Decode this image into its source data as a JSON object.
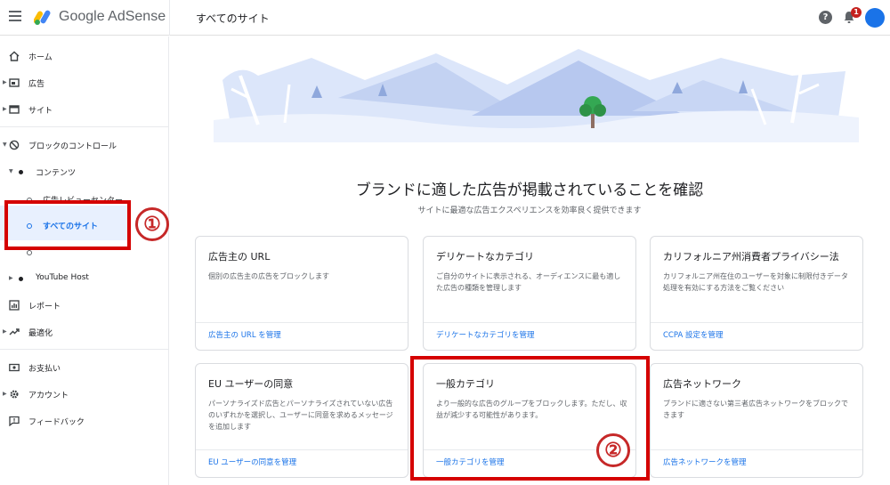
{
  "header": {
    "brand": "Google AdSense",
    "page_title": "すべてのサイト",
    "help_icon": "help-icon",
    "notification_count": "1",
    "colors": {
      "brand_blue": "#4285f4",
      "brand_yellow": "#fbbc04",
      "brand_green": "#34a853",
      "badge_red": "#c5221f"
    }
  },
  "sidebar": {
    "items": [
      {
        "label": "ホーム",
        "icon": "home-icon"
      },
      {
        "label": "広告",
        "icon": "ads-icon"
      },
      {
        "label": "サイト",
        "icon": "sites-icon"
      },
      {
        "label": "ブロックのコントロール",
        "icon": "block-icon"
      },
      {
        "label": "コンテンツ"
      },
      {
        "label": "広告レビューセンター"
      },
      {
        "label": "すべてのサイト"
      },
      {
        "label": "YouTube Host"
      },
      {
        "label": "レポート",
        "icon": "reports-icon"
      },
      {
        "label": "最適化",
        "icon": "optimization-icon"
      },
      {
        "label": "お支払い",
        "icon": "payments-icon"
      },
      {
        "label": "アカウント",
        "icon": "gear-icon"
      },
      {
        "label": "フィードバック",
        "icon": "feedback-icon"
      }
    ]
  },
  "annotations": {
    "marker1": "①",
    "marker2": "②",
    "highlight_color": "#d50000"
  },
  "main": {
    "headline": "ブランドに適した広告が掲載されていることを確認",
    "subhead": "サイトに最適な広告エクスペリエンスを効率良く提供できます",
    "cards": [
      {
        "title": "広告主の URL",
        "desc": "個別の広告主の広告をブロックします",
        "link": "広告主の URL を管理"
      },
      {
        "title": "デリケートなカテゴリ",
        "desc": "ご自分のサイトに表示される、オーディエンスに最も適した広告の種類を管理します",
        "link": "デリケートなカテゴリを管理"
      },
      {
        "title": "カリフォルニア州消費者プライバシー法",
        "desc": "カリフォルニア州在住のユーザーを対象に制限付きデータ処理を有効にする方法をご覧ください",
        "link": "CCPA 設定を管理"
      },
      {
        "title": "EU ユーザーの同意",
        "desc": "パーソナライズド広告とパーソナライズされていない広告のいずれかを選択し、ユーザーに同意を求めるメッセージを追加します",
        "link": "EU ユーザーの同意を管理"
      },
      {
        "title": "一般カテゴリ",
        "desc": "より一般的な広告のグループをブロックします。ただし、収益が減少する可能性があります。",
        "link": "一般カテゴリを管理"
      },
      {
        "title": "広告ネットワーク",
        "desc": "ブランドに適さない第三者広告ネットワークをブロックできます",
        "link": "広告ネットワークを管理"
      }
    ]
  }
}
